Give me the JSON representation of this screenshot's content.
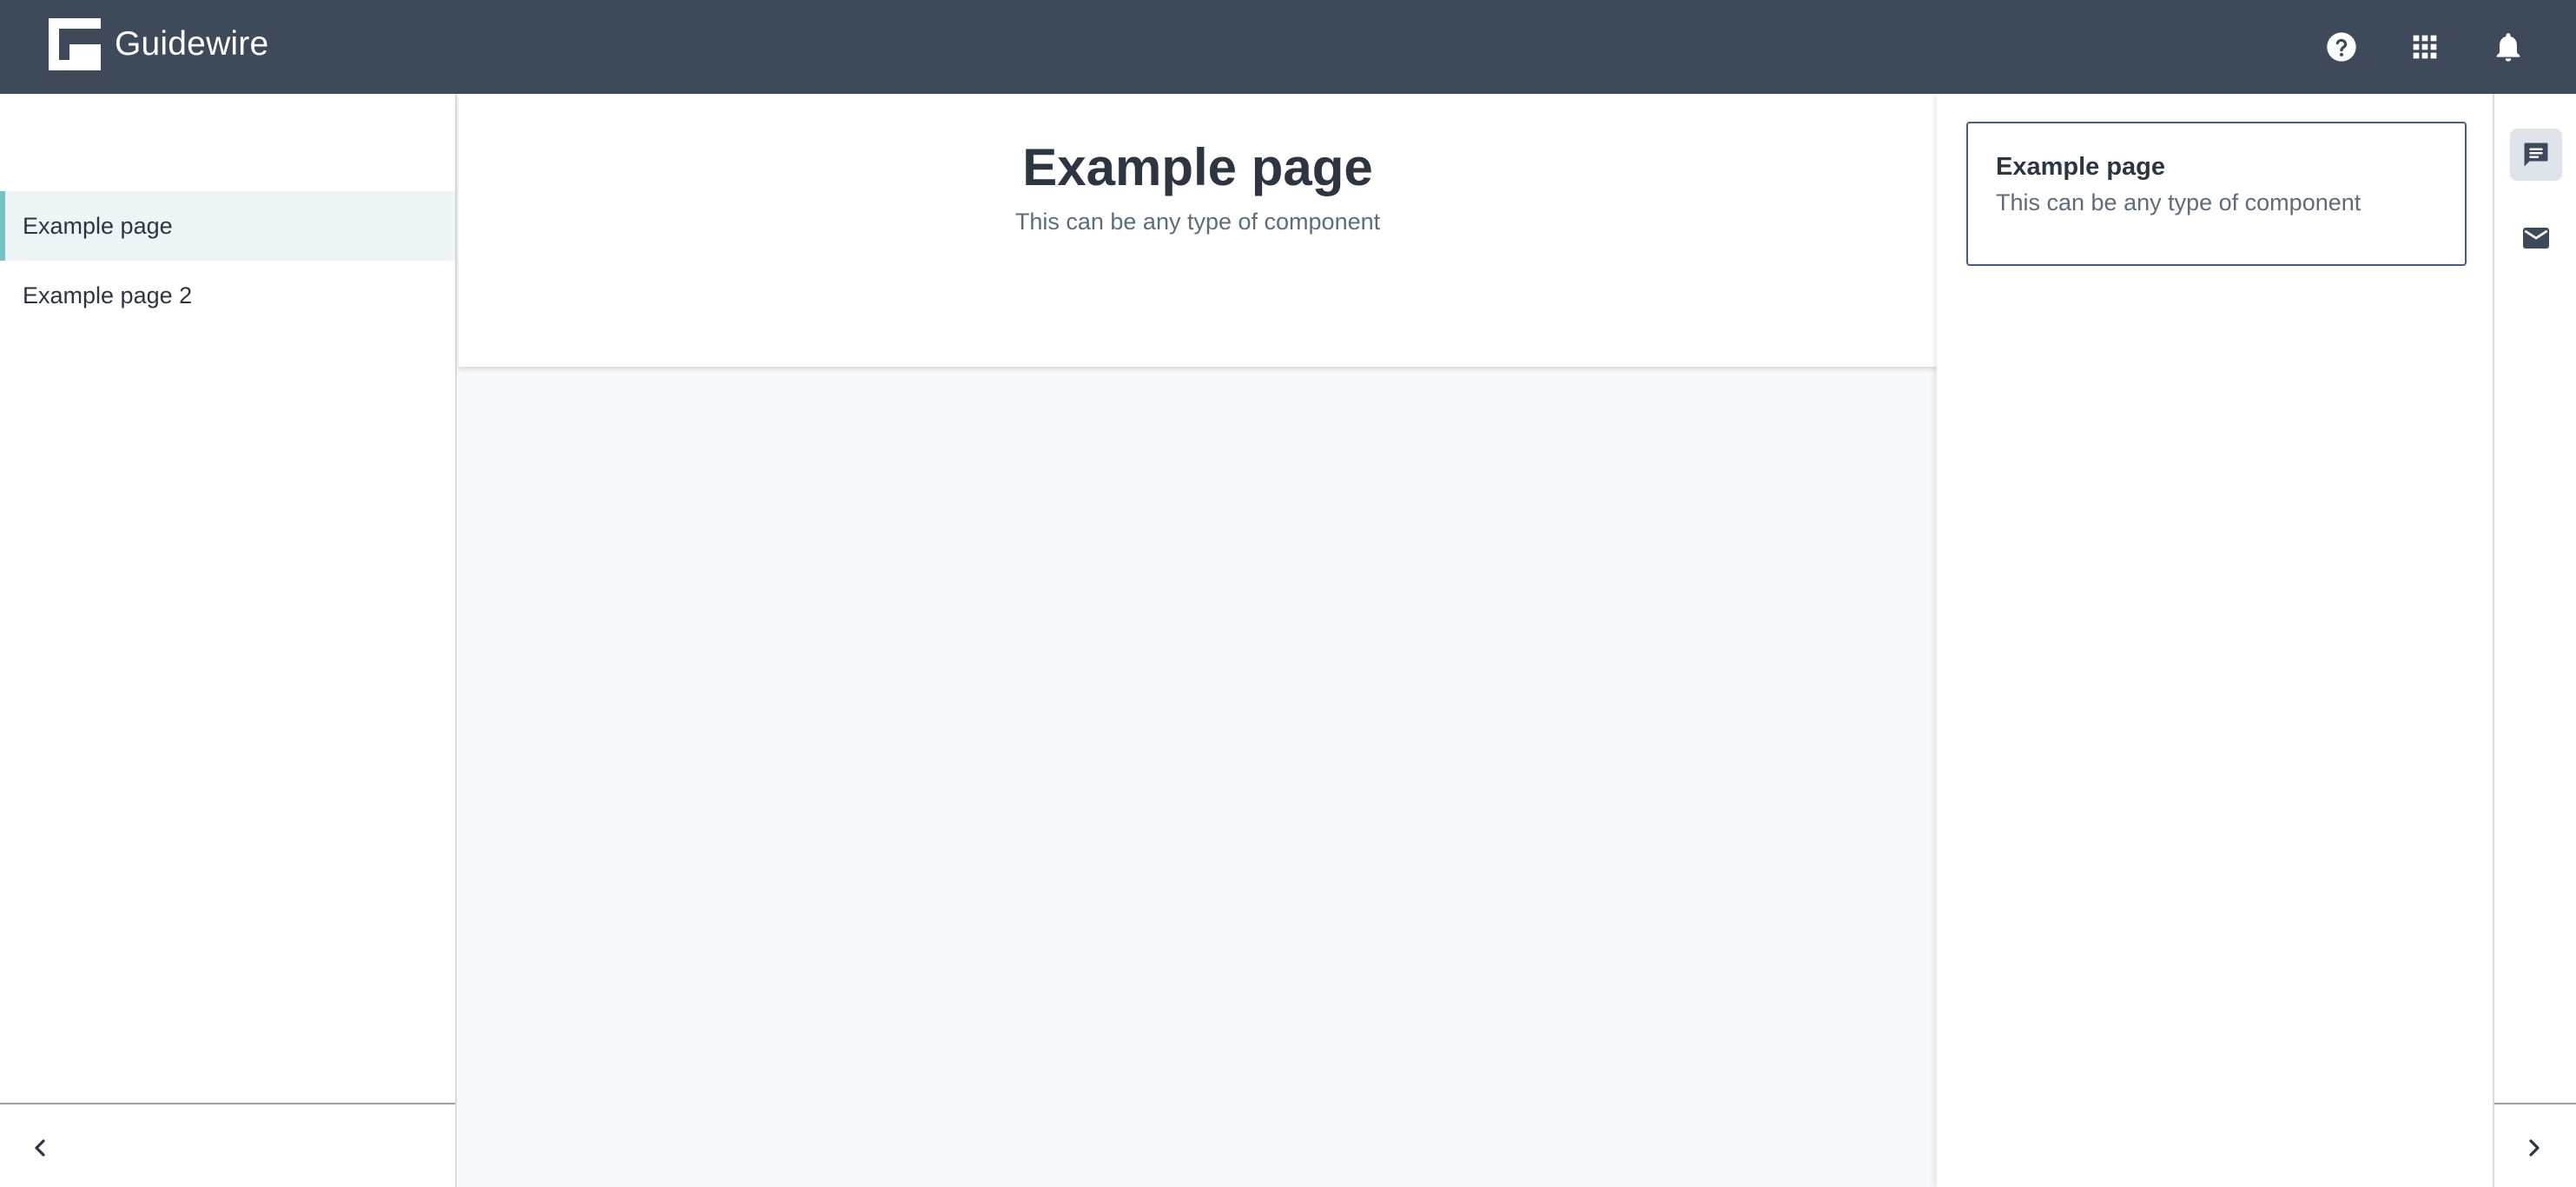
{
  "header": {
    "brand": "Guidewire",
    "icons": [
      "help-icon",
      "apps-grid-icon",
      "notifications-bell-icon"
    ]
  },
  "leftnav": {
    "items": [
      {
        "label": "Example page",
        "active": true
      },
      {
        "label": "Example page 2",
        "active": false
      }
    ],
    "collapse_icon": "chevron-left-icon"
  },
  "main": {
    "title": "Example page",
    "subtitle": "This can be any type of component"
  },
  "rightpanel": {
    "card": {
      "title": "Example page",
      "subtitle": "This can be any type of component"
    }
  },
  "rail": {
    "icons": [
      "chat-icon",
      "mail-icon"
    ],
    "expand_icon": "chevron-right-icon"
  },
  "colors": {
    "header_bg": "#3e4a5a",
    "accent": "#75c4c3",
    "active_bg": "#edf5f6",
    "page_bg": "#f6f8fa"
  }
}
